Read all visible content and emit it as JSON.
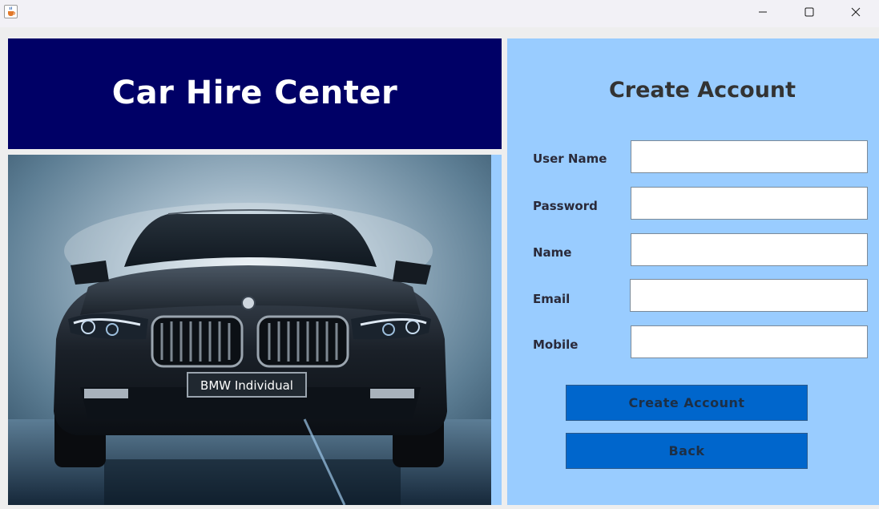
{
  "window": {
    "icon": "java-cup-icon",
    "controls": [
      "minimize-icon",
      "maximize-icon",
      "close-icon"
    ]
  },
  "header": {
    "title": "Car Hire Center",
    "background": "#000066"
  },
  "car_image": {
    "plate_text": "BMW Individual"
  },
  "form": {
    "title": "Create Account",
    "background": "#99ccff",
    "fields": [
      {
        "label": "User Name",
        "value": "",
        "placeholder": ""
      },
      {
        "label": "Password",
        "value": "",
        "placeholder": ""
      },
      {
        "label": "Name",
        "value": "",
        "placeholder": ""
      },
      {
        "label": "Email",
        "value": "",
        "placeholder": ""
      },
      {
        "label": "Mobile",
        "value": "",
        "placeholder": ""
      }
    ],
    "buttons": {
      "create_label": "Create Account",
      "back_label": "Back",
      "color": "#0066cc"
    }
  }
}
